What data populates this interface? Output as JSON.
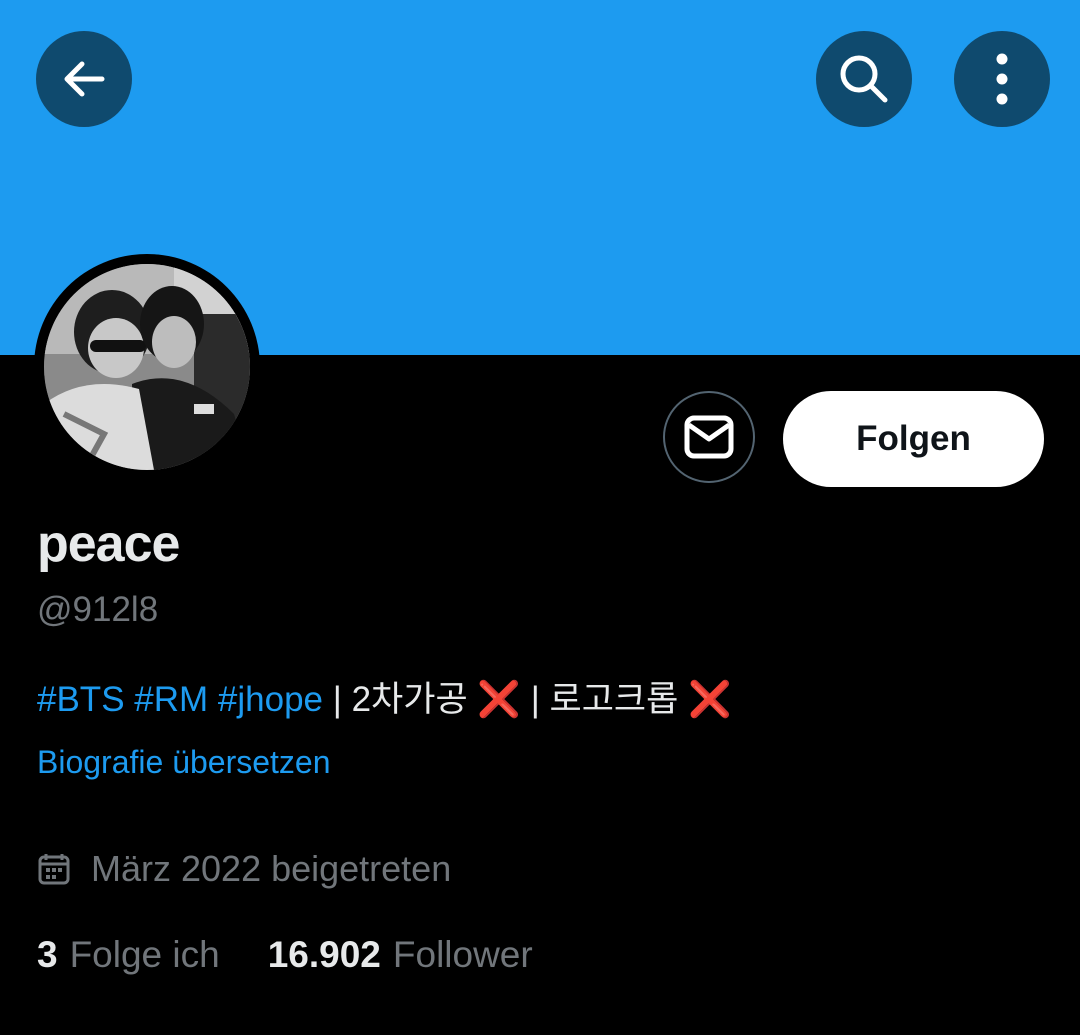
{
  "header": {
    "back_icon": "arrow-left-icon",
    "search_icon": "search-icon",
    "more_icon": "more-vertical-icon",
    "banner_color": "#1d9bf0"
  },
  "profile": {
    "display_name": "peace",
    "handle": "@912l8",
    "avatar": "profile-photo",
    "message_icon": "envelope-icon",
    "follow_label": "Folgen"
  },
  "bio": {
    "tags": [
      "#BTS",
      "#RM",
      "#jhope"
    ],
    "sep1": " | ",
    "text1": "2차가공 ",
    "x1": "❌",
    "sep2": " | ",
    "text2": "로고크롭 ",
    "x2": "❌",
    "translate_label": "Biografie übersetzen"
  },
  "joined": {
    "icon": "calendar-icon",
    "text": "März 2022 beigetreten"
  },
  "stats": {
    "following_count": "3",
    "following_label": "Folge ich",
    "followers_count": "16.902",
    "followers_label": "Follower"
  },
  "colors": {
    "accent": "#1d9bf0",
    "background": "#000000",
    "secondary_text": "#71767b",
    "red_x": "#f4212e"
  }
}
